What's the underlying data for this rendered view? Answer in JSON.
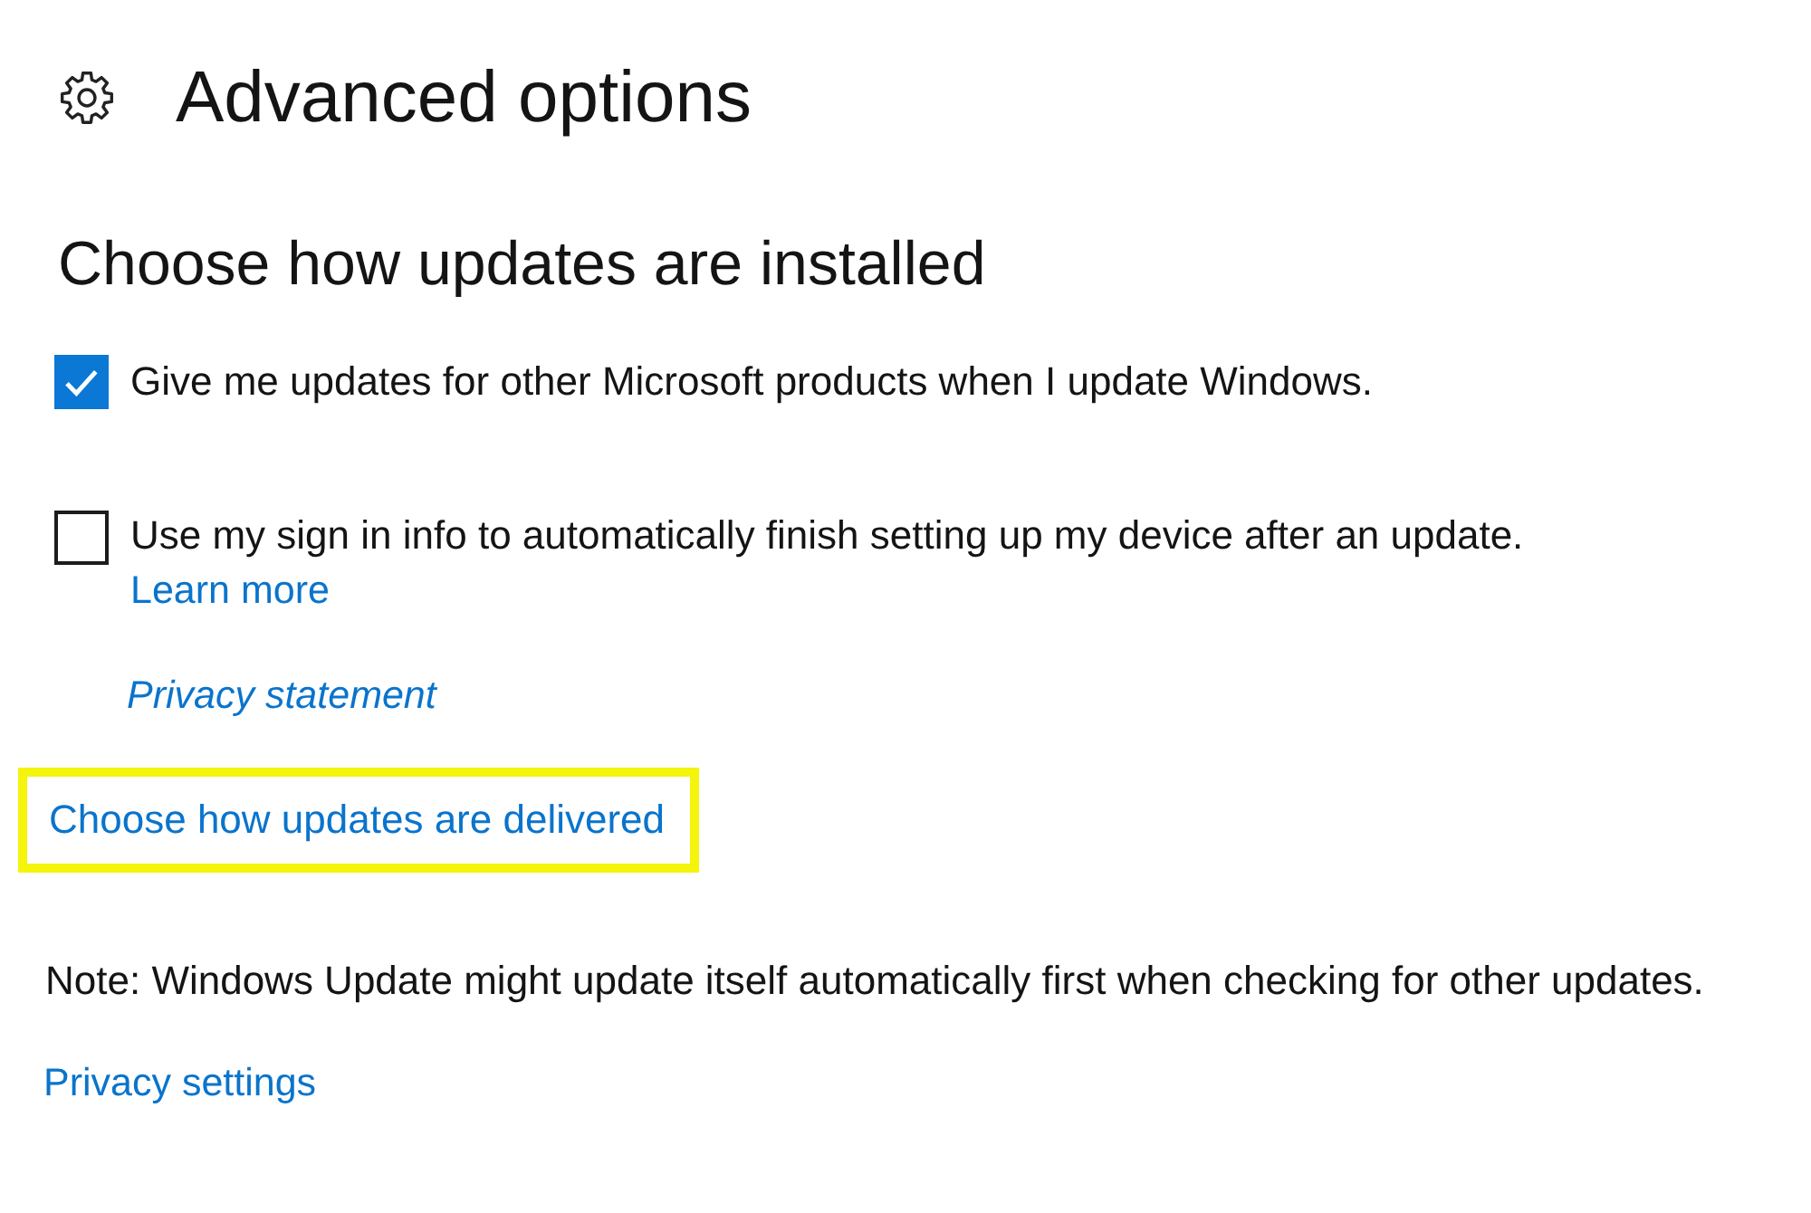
{
  "header": {
    "title": "Advanced options"
  },
  "section": {
    "heading": "Choose how updates are installed"
  },
  "options": [
    {
      "label": "Give me updates for other Microsoft products when I update Windows.",
      "checked": true
    },
    {
      "label": "Use my sign in info to automatically finish setting up my device after an update.",
      "checked": false,
      "link": "Learn more"
    }
  ],
  "privacy_statement_link": "Privacy statement",
  "delivery_link": {
    "label": "Choose how updates are delivered",
    "highlighted": true
  },
  "note": "Note: Windows Update might update itself automatically first when checking for other updates.",
  "privacy_settings_link": "Privacy settings"
}
